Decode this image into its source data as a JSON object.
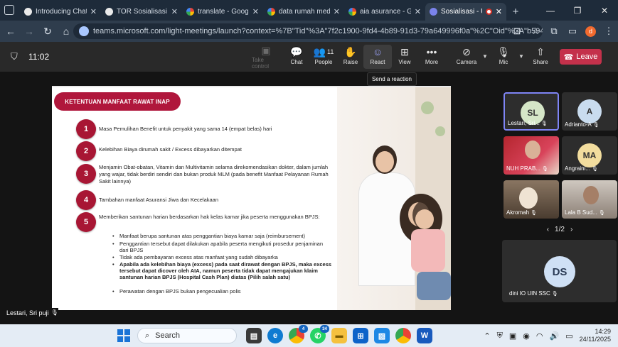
{
  "browser": {
    "tabs": [
      {
        "title": "Introducing ChatGPT",
        "icon": "openai-icon",
        "color": "#e9e9e9"
      },
      {
        "title": "TOR Sosialisasi Asuransi",
        "icon": "openai-icon",
        "color": "#e9e9e9"
      },
      {
        "title": "translate - Google Search",
        "icon": "google-icon",
        "color": "#4285f4"
      },
      {
        "title": "data rumah medis",
        "icon": "google-icon",
        "color": "#4285f4"
      },
      {
        "title": "aia asurance - Google",
        "icon": "google-icon",
        "color": "#4285f4"
      },
      {
        "title": "Sosialisasi - UIN",
        "icon": "teams-icon",
        "color": "#7b83eb",
        "active": true
      }
    ],
    "url": "teams.microsoft.com/light-meetings/launch?context=%7B\"Tid\"%3A\"7f2c1900-9fd4-4b89-91d3-79a649996f0a\"%2C\"Oid\"%3A\"b594d8ad-a5..."
  },
  "teams": {
    "timer": "11:02",
    "toolbar": {
      "take_control": "Take control",
      "chat": "Chat",
      "people": "People",
      "people_count": "11",
      "raise": "Raise",
      "react": "React",
      "view": "View",
      "more": "More",
      "camera": "Camera",
      "mic": "Mic",
      "share": "Share",
      "leave": "Leave"
    },
    "tooltip": "Send a reaction",
    "presenter": "Lestari, Sri puji",
    "participants": [
      {
        "name": "Lestari, Sri...",
        "initials": "SL",
        "avatar_color": "#d5e6c7"
      },
      {
        "name": "Adrianto-A",
        "initials": "A",
        "avatar_color": "#c9dcef"
      },
      {
        "name": "NUH PRAB...",
        "initials": "",
        "avatar_color": "#b5262f"
      },
      {
        "name": "Angraini...",
        "initials": "MA",
        "avatar_color": "#f2dd9e"
      },
      {
        "name": "Akromah",
        "initials": "",
        "avatar_color": "#6a5a48"
      },
      {
        "name": "Lala B Sud...",
        "initials": "",
        "avatar_color": "#9c8f84"
      }
    ],
    "pager": "1/2",
    "big_participant": {
      "name": "dini IO UIN SSC",
      "initials": "DS"
    }
  },
  "slide": {
    "heading": "KETENTUAN MANFAAT RAWAT INAP",
    "items": [
      {
        "num": "1",
        "text": "Masa Pemulihan Benefit untuk penyakit yang sama 14 (empat belas) hari"
      },
      {
        "num": "2",
        "text": "Kelebihan Biaya dirumah sakit / Excess dibayarkan ditempat"
      },
      {
        "num": "3",
        "text": "Menjamin Obat-obatan, Vitamin dan Multivitamin selama direkomendasikan dokter, dalam jumlah yang wajar, tidak berdiri sendiri dan bukan produk MLM (pada benefit Manfaat Pelayanan Rumah Sakit lainnya)"
      },
      {
        "num": "4",
        "text": "Tambahan manfaat Asuransi Jiwa dan Kecelakaan"
      },
      {
        "num": "5",
        "text": "Memberikan santunan harian berdasarkan hak kelas kamar jika peserta menggunakan BPJS:"
      }
    ],
    "subitems": [
      {
        "text": "Manfaat berupa santunan atas penggantian biaya kamar saja (reimbursement)",
        "bold": false
      },
      {
        "text": "Penggantian tersebut dapat dilakukan apabila peserta mengikuti prosedur penjaminan dari BPJS",
        "bold": false
      },
      {
        "text": "Tidak ada pembayaran excess atas manfaat yang sudah dibayarka",
        "bold": false
      },
      {
        "text": "Apabila ada kelebihan biaya (excess) pada saat dirawat dengan BPJS, maka excess tersebut dapat dicover oleh AIA, namun peserta tidak dapat mengajukan klaim santunan harian BPJS (Hospital Cash Plan) diatas (Pilih salah satu)",
        "bold": true
      },
      {
        "text": "Perawatan dengan BPJS bukan pengecualian polis",
        "bold": false
      }
    ]
  },
  "taskbar": {
    "search_placeholder": "Search",
    "chrome_badge": "4",
    "whatsapp_badge": "34",
    "time": "14:29",
    "date": "24/11/2025"
  }
}
